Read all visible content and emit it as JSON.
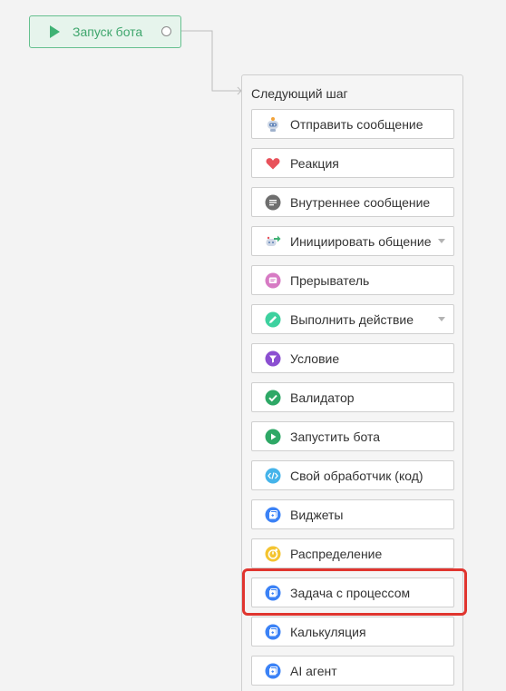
{
  "start_node": {
    "label": "Запуск бота"
  },
  "panel": {
    "title": "Следующий шаг",
    "items": [
      {
        "label": "Отправить сообщение",
        "icon": "robot-icon"
      },
      {
        "label": "Реакция",
        "icon": "heart-icon"
      },
      {
        "label": "Внутреннее сообщение",
        "icon": "chat-bubble-icon"
      },
      {
        "label": "Инициировать общение",
        "icon": "robot-arrow-icon",
        "has_dropdown": true
      },
      {
        "label": "Прерыватель",
        "icon": "interrupt-icon"
      },
      {
        "label": "Выполнить действие",
        "icon": "pencil-icon",
        "has_dropdown": true
      },
      {
        "label": "Условие",
        "icon": "filter-icon"
      },
      {
        "label": "Валидатор",
        "icon": "checkmark-icon"
      },
      {
        "label": "Запустить бота",
        "icon": "play-circle-icon"
      },
      {
        "label": "Свой обработчик (код)",
        "icon": "code-icon"
      },
      {
        "label": "Виджеты",
        "icon": "widget-icon"
      },
      {
        "label": "Распределение",
        "icon": "distribution-icon"
      },
      {
        "label": "Задача с процессом",
        "icon": "widget-icon",
        "highlighted": true
      },
      {
        "label": "Калькуляция",
        "icon": "widget-icon"
      },
      {
        "label": "AI агент",
        "icon": "widget-icon"
      }
    ]
  },
  "colors": {
    "start_node_bg": "#e6f4ec",
    "start_node_border": "#66c08f",
    "start_node_text": "#3fa66d",
    "highlight": "#e0352f",
    "widget_blue": "#3b82f6"
  }
}
